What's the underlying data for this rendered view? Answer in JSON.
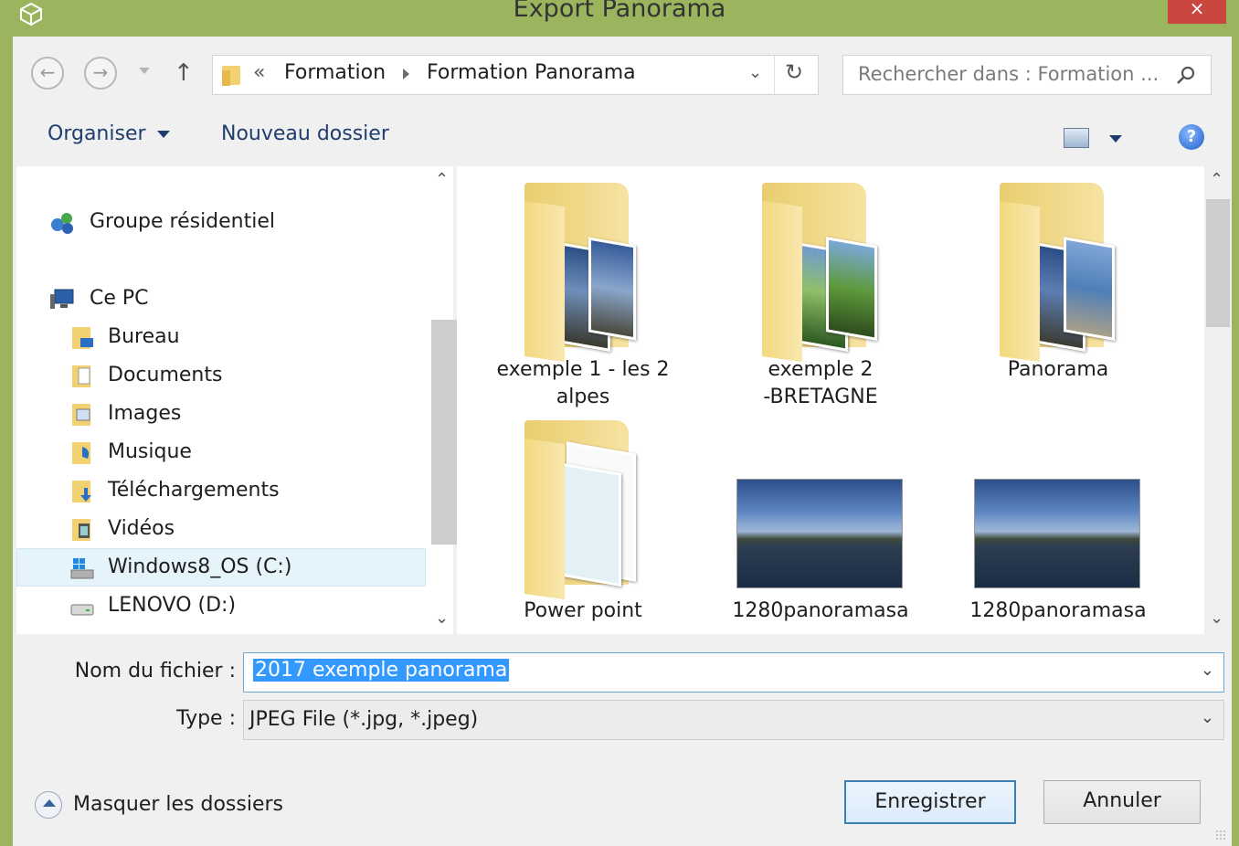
{
  "window": {
    "title": "Export Panorama",
    "close_label": "×",
    "frame_color": "#9bb55f",
    "close_color": "#c9473f"
  },
  "address_bar": {
    "overflow_label": "«",
    "breadcrumbs": [
      "Formation",
      "Formation Panorama"
    ],
    "dropdown_label": "⌄",
    "refresh_label": "↻"
  },
  "search": {
    "placeholder": "Rechercher dans : Formation ..."
  },
  "nav_buttons": {
    "back": "←",
    "forward": "→",
    "up": "↑"
  },
  "toolbar": {
    "organize_label": "Organiser",
    "new_folder_label": "Nouveau dossier",
    "help_label": "?"
  },
  "navigation": {
    "items": [
      {
        "label": "Groupe résidentiel",
        "icon": "homegroup-icon"
      },
      {
        "label": "Ce PC",
        "icon": "computer-icon"
      },
      {
        "label": "Bureau",
        "icon": "desktop-folder-icon"
      },
      {
        "label": "Documents",
        "icon": "documents-folder-icon"
      },
      {
        "label": "Images",
        "icon": "pictures-folder-icon"
      },
      {
        "label": "Musique",
        "icon": "music-folder-icon"
      },
      {
        "label": "Téléchargements",
        "icon": "downloads-folder-icon"
      },
      {
        "label": "Vidéos",
        "icon": "videos-folder-icon"
      },
      {
        "label": "Windows8_OS (C:)",
        "icon": "windows-drive-icon"
      },
      {
        "label": "LENOVO (D:)",
        "icon": "drive-icon"
      }
    ],
    "selected": "Windows8_OS (C:)"
  },
  "files": [
    {
      "name_line1": "exemple 1 - les 2",
      "name_line2": "alpes",
      "type": "folder"
    },
    {
      "name_line1": "exemple 2",
      "name_line2": "-BRETAGNE",
      "type": "folder"
    },
    {
      "name_line1": "Panorama",
      "name_line2": "",
      "type": "folder"
    },
    {
      "name_line1": "Power point",
      "name_line2": "",
      "type": "folder"
    },
    {
      "name_line1": "1280panoramasa",
      "name_line2": "",
      "type": "image"
    },
    {
      "name_line1": "1280panoramasa",
      "name_line2": "",
      "type": "image"
    }
  ],
  "form": {
    "filename_label": "Nom du fichier :",
    "filename_value": "2017 exemple panorama",
    "type_label": "Type :",
    "type_value": "JPEG File (*.jpg, *.jpeg)"
  },
  "footer": {
    "hide_folders_label": "Masquer les dossiers",
    "save_label": "Enregistrer",
    "cancel_label": "Annuler"
  },
  "scroll_arrows": {
    "up": "⌃",
    "down": "⌄"
  }
}
